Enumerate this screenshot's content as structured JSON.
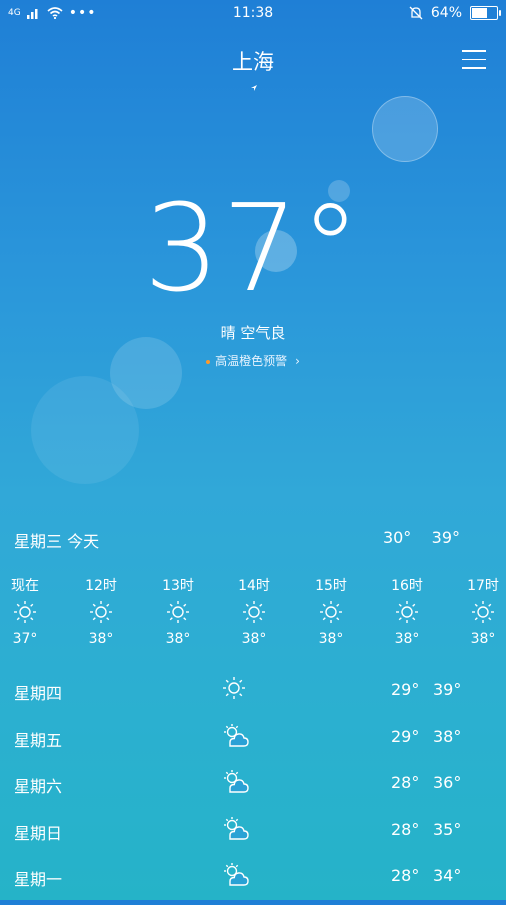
{
  "status_bar": {
    "signal": "4G",
    "time": "11:38",
    "battery": "64%",
    "battery_level": 0.64
  },
  "header": {
    "city": "上海"
  },
  "current": {
    "temperature": "37°",
    "condition": "晴  空气良",
    "alert": "高温橙色预警"
  },
  "today": {
    "label": "星期三  今天",
    "low": "30°",
    "high": "39°"
  },
  "hourly": [
    {
      "time": "现在",
      "icon": "sun-icon",
      "temp": "37°"
    },
    {
      "time": "12时",
      "icon": "sun-icon",
      "temp": "38°"
    },
    {
      "time": "13时",
      "icon": "sun-icon",
      "temp": "38°"
    },
    {
      "time": "14时",
      "icon": "sun-icon",
      "temp": "38°"
    },
    {
      "time": "15时",
      "icon": "sun-icon",
      "temp": "38°"
    },
    {
      "time": "16时",
      "icon": "sun-icon",
      "temp": "38°"
    },
    {
      "time": "17时",
      "icon": "sun-icon",
      "temp": "38°"
    }
  ],
  "daily": [
    {
      "day": "星期四",
      "icon": "sun-icon",
      "low": "29°",
      "high": "39°"
    },
    {
      "day": "星期五",
      "icon": "partly-cloudy-icon",
      "low": "29°",
      "high": "38°"
    },
    {
      "day": "星期六",
      "icon": "partly-cloudy-icon",
      "low": "28°",
      "high": "36°"
    },
    {
      "day": "星期日",
      "icon": "partly-cloudy-icon",
      "low": "28°",
      "high": "35°"
    },
    {
      "day": "星期一",
      "icon": "partly-cloudy-icon",
      "low": "28°",
      "high": "34°"
    }
  ]
}
